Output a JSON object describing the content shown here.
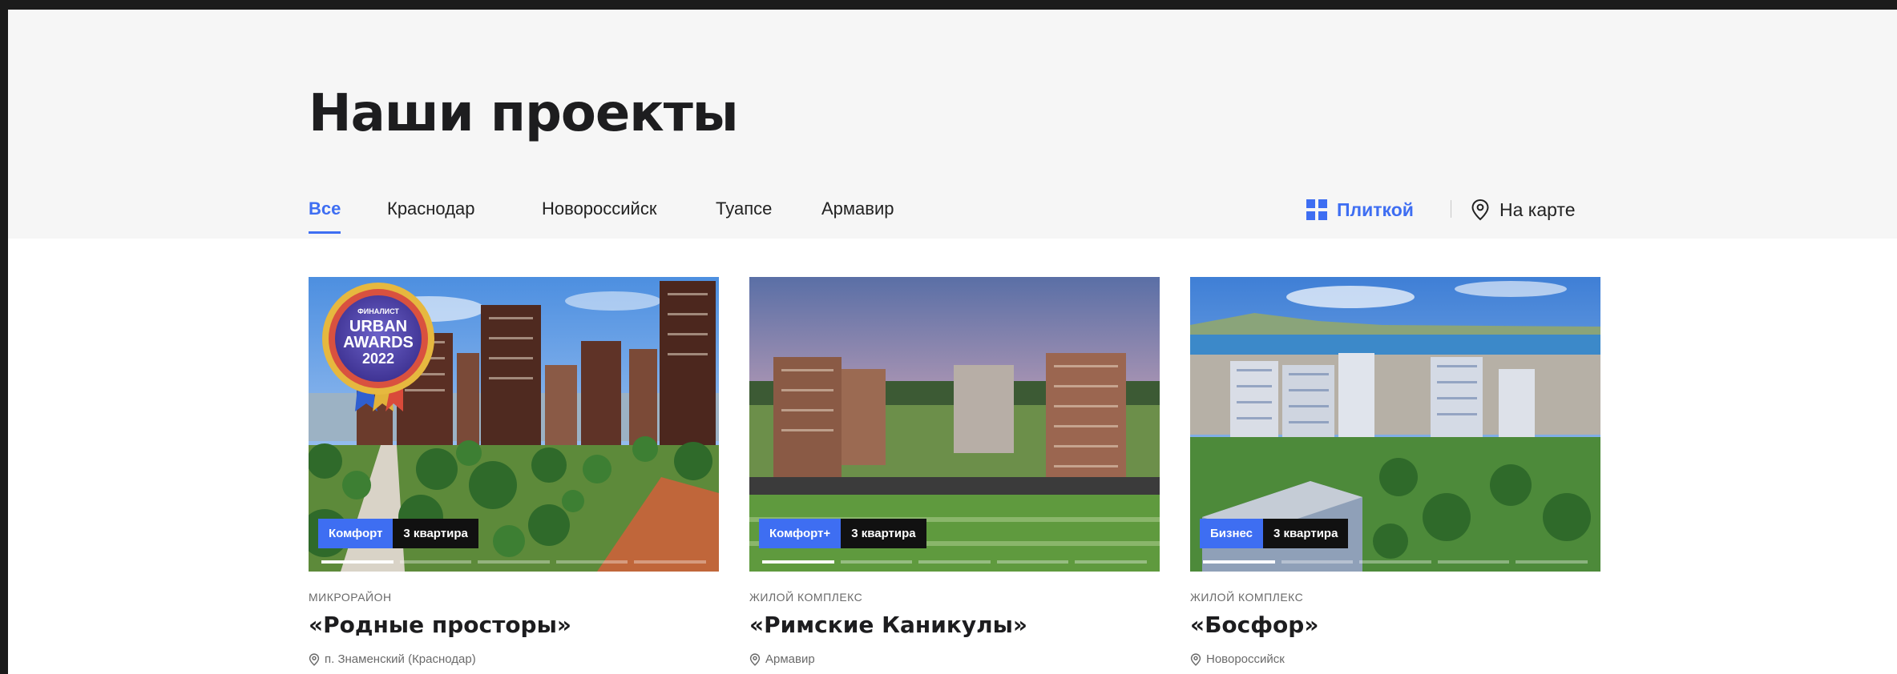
{
  "page": {
    "title": "Наши проекты"
  },
  "filters": {
    "tabs": [
      {
        "label": "Все",
        "active": true
      },
      {
        "label": "Краснодар",
        "active": false
      },
      {
        "label": "Новороссийск",
        "active": false
      },
      {
        "label": "Туапсе",
        "active": false
      },
      {
        "label": "Армавир",
        "active": false
      }
    ]
  },
  "view": {
    "tile_label": "Плиткой",
    "map_label": "На карте",
    "tile_icon": "grid-icon",
    "map_icon": "map-pin-icon",
    "active": "tile"
  },
  "colors": {
    "accent": "#3e6ef2",
    "dark": "#1d1d1f",
    "muted": "#6a6a6a"
  },
  "projects": [
    {
      "type": "Микрорайон",
      "name": "«Родные просторы»",
      "location": "п. Знаменский (Краснодар)",
      "class_badge": "Комфорт",
      "quarter_badge": "3 квартира",
      "award": {
        "line1": "ФИНАЛИСТ",
        "line2": "URBAN",
        "line3": "AWARDS",
        "line4": "2022"
      }
    },
    {
      "type": "Жилой комплекс",
      "name": "«Римские Каникулы»",
      "location": "Армавир",
      "class_badge": "Комфорт+",
      "quarter_badge": "3 квартира"
    },
    {
      "type": "Жилой комплекс",
      "name": "«Босфор»",
      "location": "Новороссийск",
      "class_badge": "Бизнес",
      "quarter_badge": "3 квартира"
    }
  ]
}
